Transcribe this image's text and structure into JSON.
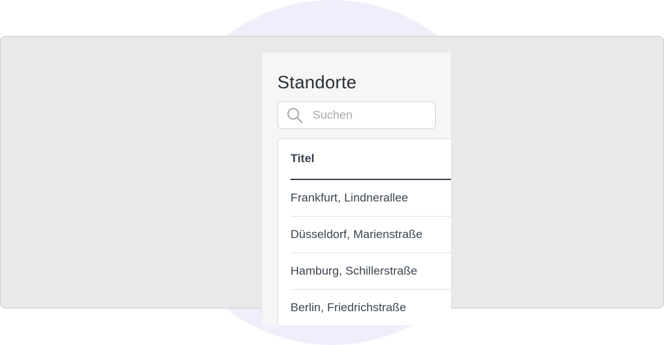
{
  "panel": {
    "title": "Standorte"
  },
  "search": {
    "placeholder": "Suchen",
    "icon": "search-icon"
  },
  "table": {
    "columns": [
      "Titel"
    ],
    "rows": [
      "Frankfurt, Lindnerallee",
      "Düsseldorf, Marienstraße",
      "Hamburg, Schillerstraße",
      "Berlin, Friedrichstraße"
    ]
  },
  "colors": {
    "background_circle": "#f1eefb",
    "frame": "#e9e9e9",
    "panel": "#f6f6f6",
    "text": "#3b444f"
  }
}
